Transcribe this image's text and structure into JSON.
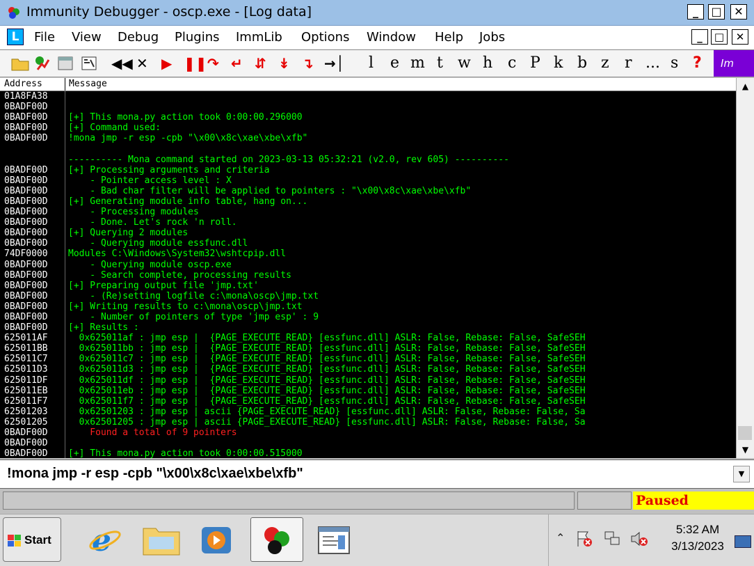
{
  "window": {
    "title": "Immunity Debugger - oscp.exe - [Log data]",
    "controls": {
      "minimize": "_",
      "restore": "🗗",
      "close": "✕"
    }
  },
  "menu": {
    "logo": "L",
    "items": [
      "File",
      "View",
      "Debug",
      "Plugins",
      "ImmLib",
      "Options",
      "Window",
      "Help",
      "Jobs"
    ],
    "controls": {
      "minimize": "_",
      "restore": "🗗",
      "close": "✕"
    }
  },
  "toolbar": {
    "letters": [
      "l",
      "e",
      "m",
      "t",
      "w",
      "h",
      "c",
      "P",
      "k",
      "b",
      "z",
      "r",
      "...",
      "s",
      "?"
    ],
    "plugin_label": "Im"
  },
  "log": {
    "columns": {
      "address": "Address",
      "message": "Message"
    },
    "rows": [
      {
        "address": "01A8FA38",
        "message": ""
      },
      {
        "address": "0BADF00D",
        "message": ""
      },
      {
        "address": "0BADF00D",
        "message": "[+] This mona.py action took 0:00:00.296000"
      },
      {
        "address": "0BADF00D",
        "message": "[+] Command used:"
      },
      {
        "address": "0BADF00D",
        "message": "!mona jmp -r esp -cpb \"\\x00\\x8c\\xae\\xbe\\xfb\""
      },
      {
        "address": "",
        "message": ""
      },
      {
        "address": "",
        "message": "---------- Mona command started on 2023-03-13 05:32:21 (v2.0, rev 605) ----------"
      },
      {
        "address": "0BADF00D",
        "message": "[+] Processing arguments and criteria"
      },
      {
        "address": "0BADF00D",
        "message": "    - Pointer access level : X"
      },
      {
        "address": "0BADF00D",
        "message": "    - Bad char filter will be applied to pointers : \"\\x00\\x8c\\xae\\xbe\\xfb\""
      },
      {
        "address": "0BADF00D",
        "message": "[+] Generating module info table, hang on..."
      },
      {
        "address": "0BADF00D",
        "message": "    - Processing modules"
      },
      {
        "address": "0BADF00D",
        "message": "    - Done. Let's rock 'n roll."
      },
      {
        "address": "0BADF00D",
        "message": "[+] Querying 2 modules"
      },
      {
        "address": "0BADF00D",
        "message": "    - Querying module essfunc.dll"
      },
      {
        "address": "74DF0000",
        "message": "Modules C:\\Windows\\System32\\wshtcpip.dll"
      },
      {
        "address": "0BADF00D",
        "message": "    - Querying module oscp.exe"
      },
      {
        "address": "0BADF00D",
        "message": "    - Search complete, processing results"
      },
      {
        "address": "0BADF00D",
        "message": "[+] Preparing output file 'jmp.txt'"
      },
      {
        "address": "0BADF00D",
        "message": "    - (Re)setting logfile c:\\mona\\oscp\\jmp.txt"
      },
      {
        "address": "0BADF00D",
        "message": "[+] Writing results to c:\\mona\\oscp\\jmp.txt"
      },
      {
        "address": "0BADF00D",
        "message": "    - Number of pointers of type 'jmp esp' : 9"
      },
      {
        "address": "0BADF00D",
        "message": "[+] Results :"
      },
      {
        "address": "625011AF",
        "message": "  0x625011af : jmp esp |  {PAGE_EXECUTE_READ} [essfunc.dll] ASLR: False, Rebase: False, SafeSEH"
      },
      {
        "address": "625011BB",
        "message": "  0x625011bb : jmp esp |  {PAGE_EXECUTE_READ} [essfunc.dll] ASLR: False, Rebase: False, SafeSEH"
      },
      {
        "address": "625011C7",
        "message": "  0x625011c7 : jmp esp |  {PAGE_EXECUTE_READ} [essfunc.dll] ASLR: False, Rebase: False, SafeSEH"
      },
      {
        "address": "625011D3",
        "message": "  0x625011d3 : jmp esp |  {PAGE_EXECUTE_READ} [essfunc.dll] ASLR: False, Rebase: False, SafeSEH"
      },
      {
        "address": "625011DF",
        "message": "  0x625011df : jmp esp |  {PAGE_EXECUTE_READ} [essfunc.dll] ASLR: False, Rebase: False, SafeSEH"
      },
      {
        "address": "625011EB",
        "message": "  0x625011eb : jmp esp |  {PAGE_EXECUTE_READ} [essfunc.dll] ASLR: False, Rebase: False, SafeSEH"
      },
      {
        "address": "625011F7",
        "message": "  0x625011f7 : jmp esp |  {PAGE_EXECUTE_READ} [essfunc.dll] ASLR: False, Rebase: False, SafeSEH"
      },
      {
        "address": "62501203",
        "message": "  0x62501203 : jmp esp | ascii {PAGE_EXECUTE_READ} [essfunc.dll] ASLR: False, Rebase: False, Sa"
      },
      {
        "address": "62501205",
        "message": "  0x62501205 : jmp esp | ascii {PAGE_EXECUTE_READ} [essfunc.dll] ASLR: False, Rebase: False, Sa"
      },
      {
        "address": "0BADF00D",
        "message": "    Found a total of 9 pointers",
        "red": true
      },
      {
        "address": "0BADF00D",
        "message": ""
      },
      {
        "address": "0BADF00D",
        "message": "[+] This mona.py action took 0:00:00.515000"
      }
    ]
  },
  "command": {
    "value": "!mona jmp -r esp -cpb \"\\x00\\x8c\\xae\\xbe\\xfb\""
  },
  "status": {
    "state": "Paused"
  },
  "taskbar": {
    "start_label": "Start",
    "clock_time": "5:32 AM",
    "clock_date": "3/13/2023"
  },
  "colors": {
    "log_bg": "#000000",
    "log_text": "#00ff00",
    "log_address": "#ffffff",
    "paused_bg": "#ffff00",
    "paused_text": "#e00000"
  }
}
